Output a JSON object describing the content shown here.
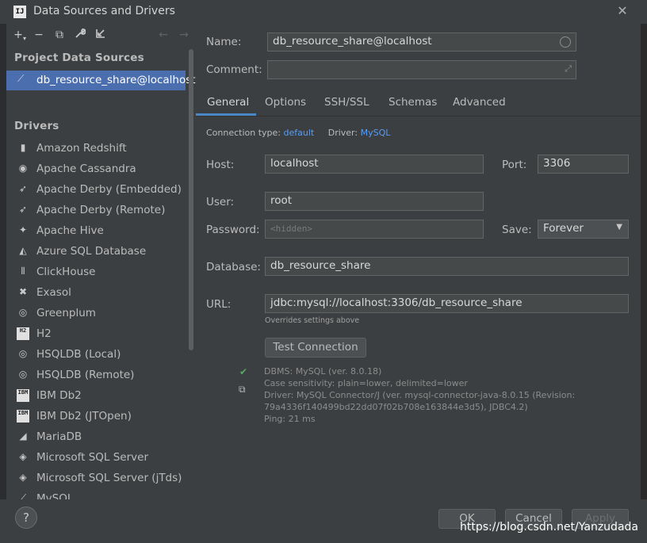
{
  "window": {
    "title": "Data Sources and Drivers",
    "logo_text": "IJ",
    "close_glyph": "✕"
  },
  "toolbar": {
    "icons": [
      "add-icon",
      "remove-icon",
      "duplicate-icon",
      "wrench-icon",
      "import-icon",
      "back-arrow-icon",
      "forward-arrow-icon"
    ]
  },
  "left": {
    "project_header": "Project Data Sources",
    "selected_source": "db_resource_share@localhost",
    "drivers_header": "Drivers",
    "drivers": [
      {
        "label": "Amazon Redshift",
        "icon": "redshift-icon"
      },
      {
        "label": "Apache Cassandra",
        "icon": "cassandra-icon"
      },
      {
        "label": "Apache Derby (Embedded)",
        "icon": "derby-icon"
      },
      {
        "label": "Apache Derby (Remote)",
        "icon": "derby-icon"
      },
      {
        "label": "Apache Hive",
        "icon": "hive-icon"
      },
      {
        "label": "Azure SQL Database",
        "icon": "azure-icon"
      },
      {
        "label": "ClickHouse",
        "icon": "clickhouse-icon"
      },
      {
        "label": "Exasol",
        "icon": "exasol-icon"
      },
      {
        "label": "Greenplum",
        "icon": "greenplum-icon"
      },
      {
        "label": "H2",
        "icon": "h2-icon"
      },
      {
        "label": "HSQLDB (Local)",
        "icon": "hsqldb-icon"
      },
      {
        "label": "HSQLDB (Remote)",
        "icon": "hsqldb-icon"
      },
      {
        "label": "IBM Db2",
        "icon": "ibm-db2-icon"
      },
      {
        "label": "IBM Db2 (JTOpen)",
        "icon": "ibm-db2-icon"
      },
      {
        "label": "MariaDB",
        "icon": "mariadb-icon"
      },
      {
        "label": "Microsoft SQL Server",
        "icon": "sqlserver-icon"
      },
      {
        "label": "Microsoft SQL Server (jTds)",
        "icon": "sqlserver-icon"
      },
      {
        "label": "MySQL",
        "icon": "mysql-icon"
      }
    ]
  },
  "form": {
    "name_label": "Name:",
    "name_value": "db_resource_share@localhost",
    "comment_label": "Comment:",
    "comment_value": "",
    "tabs": [
      "General",
      "Options",
      "SSH/SSL",
      "Schemas",
      "Advanced"
    ],
    "active_tab": "General",
    "conn_type_label": "Connection type:",
    "conn_type_value": "default",
    "driver_label": "Driver:",
    "driver_value": "MySQL",
    "host_label": "Host:",
    "host_value": "localhost",
    "port_label": "Port:",
    "port_value": "3306",
    "user_label": "User:",
    "user_value": "root",
    "password_label": "Password:",
    "password_placeholder": "<hidden>",
    "save_label": "Save:",
    "save_value": "Forever",
    "database_label": "Database:",
    "database_value": "db_resource_share",
    "url_label": "URL:",
    "url_value": "jdbc:mysql://localhost:3306/db_resource_share",
    "url_note": "Overrides settings above",
    "test_button": "Test Connection",
    "info_lines": [
      "DBMS: MySQL (ver. 8.0.18)",
      "Case sensitivity: plain=lower, delimited=lower",
      "Driver: MySQL Connector/J (ver. mysql-connector-java-8.0.15 (Revision:",
      "79a4336f140499bd22dd07f02b708e163844e3d5), JDBC4.2)",
      "Ping: 21 ms"
    ]
  },
  "buttons": {
    "help": "?",
    "ok": "OK",
    "cancel": "Cancel",
    "apply": "Apply"
  },
  "watermark": "https://blog.csdn.net/Yanzudada",
  "colors": {
    "accent": "#4b6eaf",
    "link": "#589df6",
    "success": "#59a869",
    "panel": "#3c3f41"
  }
}
